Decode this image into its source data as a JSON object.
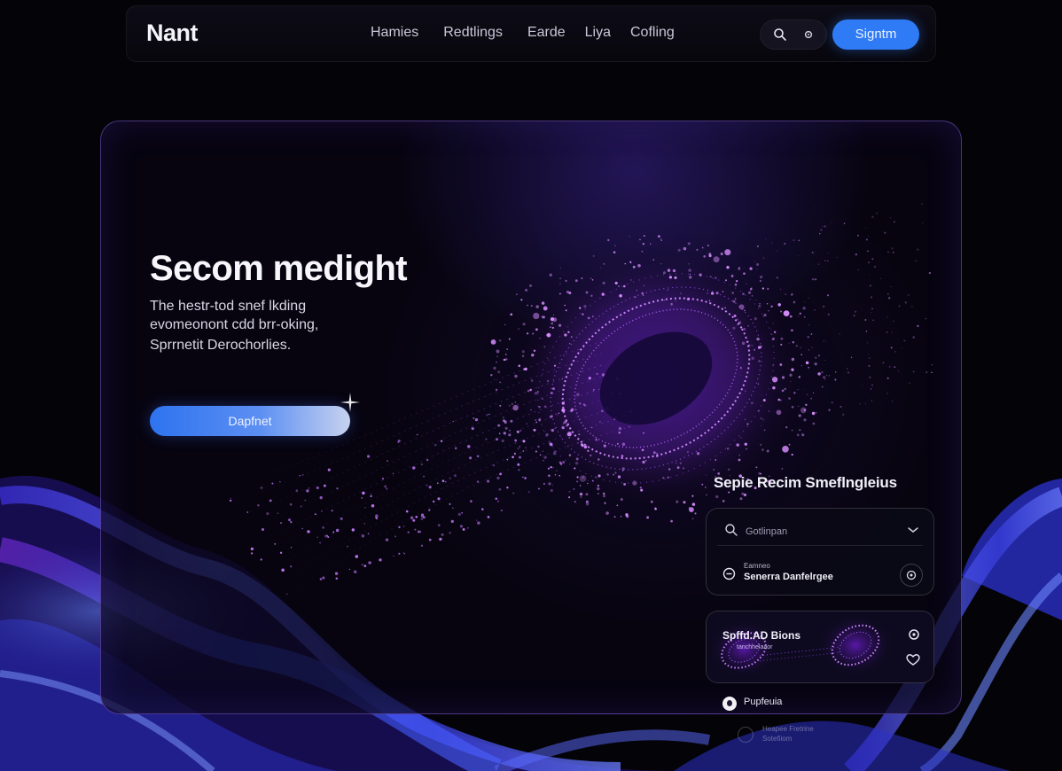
{
  "brand": {
    "logo": "Nant"
  },
  "nav": {
    "items": [
      {
        "label": "Hamies"
      },
      {
        "label": "Redtlings"
      },
      {
        "label": "Earde"
      },
      {
        "label": "Liya"
      },
      {
        "label": "Cofling"
      }
    ],
    "icons": [
      "search-icon",
      "settings-icon"
    ],
    "signup_label": "Signtm"
  },
  "hero": {
    "title": "Secom medight",
    "description_lines": [
      "The hestr-tod snef lkding",
      "evomeonont cdd brr-oking,",
      "Sprrnetit Derochorlies."
    ],
    "cta_label": "Dapfnet"
  },
  "side_panel": {
    "title": "Sepie Recim Smeflngleius",
    "search": {
      "placeholder": "Gotlinpan"
    },
    "result": {
      "small": "Eamneo",
      "main": "Senerra Danfelrgee"
    },
    "media": {
      "label": "Spffd.AD Bions",
      "sub": "tanchhelaaor"
    },
    "user": {
      "name": "Pupfeuia"
    },
    "ghost": {
      "line1": "Heapee Fretrine",
      "line2": "Sotefiiom"
    }
  },
  "colors": {
    "background": "#040308",
    "accent_blue": "#2f7bf5",
    "particle_purple": "#b455ff",
    "card_border": "#966eff"
  }
}
